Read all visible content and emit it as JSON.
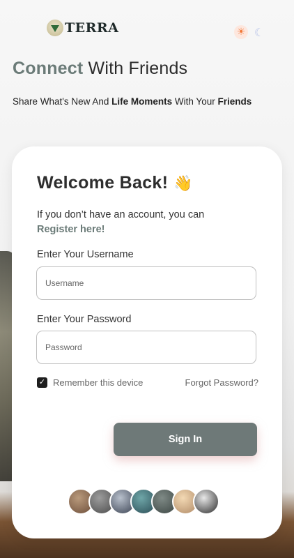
{
  "brand": {
    "name": "TERRA",
    "logo_icon": "pine-tree-icon"
  },
  "theme": {
    "light_icon": "sun-icon",
    "dark_icon": "moon-icon"
  },
  "hero": {
    "headline_accent": "Connect",
    "headline_rest": " With Friends",
    "sub_prefix": "Share What's New And ",
    "sub_bold1": "Life Moments",
    "sub_middle": " With Your ",
    "sub_bold2": "Friends"
  },
  "login": {
    "title": "Welcome Back!",
    "title_emoji": "👋",
    "intro_text": "If you don’t have an account, you can",
    "register_link": "Register here!",
    "username_label": "Enter Your Username",
    "username_placeholder": "Username",
    "password_label": "Enter Your Password",
    "password_placeholder": "Password",
    "remember_label": "Remember this device",
    "remember_checked": true,
    "forgot_link": "Forgot Password?",
    "signin_label": "Sign In"
  },
  "avatars": [
    {
      "name": "avatar-1",
      "colors": [
        "#b99a7c",
        "#6d4e3a"
      ]
    },
    {
      "name": "avatar-2",
      "colors": [
        "#9c9c9c",
        "#4c4c4c"
      ]
    },
    {
      "name": "avatar-3",
      "colors": [
        "#b8c0cc",
        "#3a4252"
      ]
    },
    {
      "name": "avatar-4",
      "colors": [
        "#6fa6a8",
        "#2b4d56"
      ]
    },
    {
      "name": "avatar-5",
      "colors": [
        "#7f8a86",
        "#3c4643"
      ]
    },
    {
      "name": "avatar-6",
      "colors": [
        "#f3d9b4",
        "#b08a66"
      ]
    },
    {
      "name": "avatar-7",
      "colors": [
        "#e8e8e8",
        "#2a2a2a"
      ]
    }
  ],
  "colors": {
    "accent": "#6b7b78",
    "button": "#6e7978"
  }
}
